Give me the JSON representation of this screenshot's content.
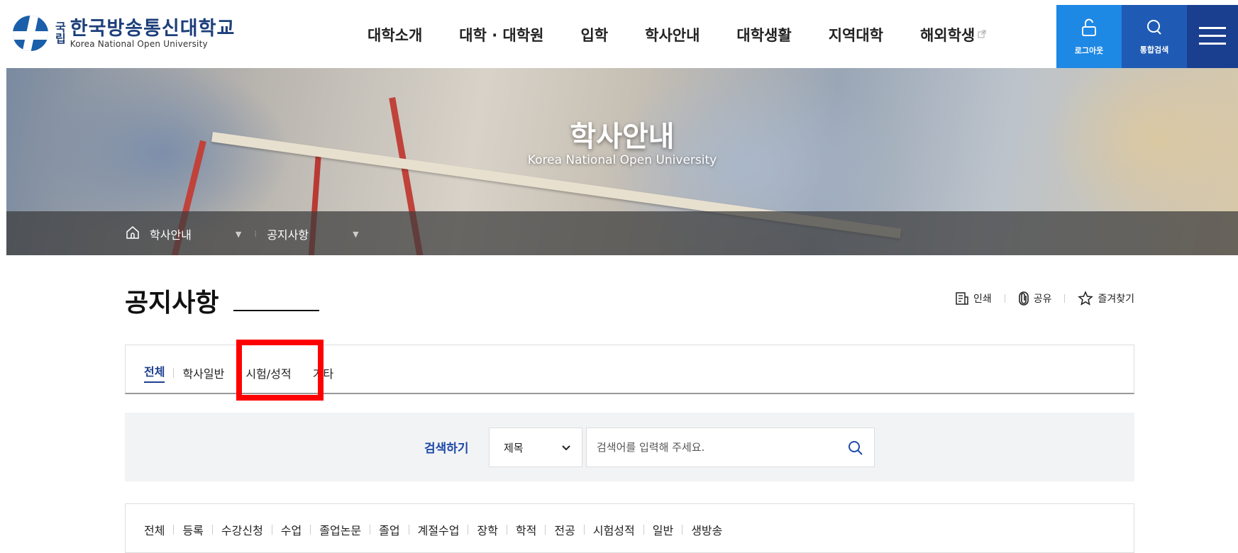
{
  "header": {
    "logo_gukrip": [
      "국",
      "립"
    ],
    "logo_ko": "한국방송통신대학교",
    "logo_en": "Korea National Open University",
    "nav": [
      "대학소개",
      "대학 · 대학원",
      "입학",
      "학사안내",
      "대학생활",
      "지역대학",
      "해외학생"
    ],
    "logout_label": "로그아웃",
    "search_label": "통합검색"
  },
  "hero": {
    "title": "학사안내",
    "subtitle": "Korea National Open University",
    "breadcrumb": [
      "학사안내",
      "공지사항"
    ]
  },
  "page": {
    "title": "공지사항",
    "tools": {
      "print": "인쇄",
      "share": "공유",
      "favorite": "즐겨찾기"
    }
  },
  "tabs": [
    "전체",
    "학사일반",
    "시험/성적",
    "기타"
  ],
  "search": {
    "label": "검색하기",
    "select_value": "제목",
    "placeholder": "검색어를 입력해 주세요."
  },
  "categories": [
    "전체",
    "등록",
    "수강신청",
    "수업",
    "졸업논문",
    "졸업",
    "계절수업",
    "장학",
    "학적",
    "전공",
    "시험성적",
    "일반",
    "생방송"
  ],
  "colors": {
    "primary": "#1f3f8f",
    "logout_bg": "#1e88e5",
    "search_bg": "#1f5bb4",
    "menu_bg": "#1b3f8f",
    "highlight": "#ff0000"
  }
}
